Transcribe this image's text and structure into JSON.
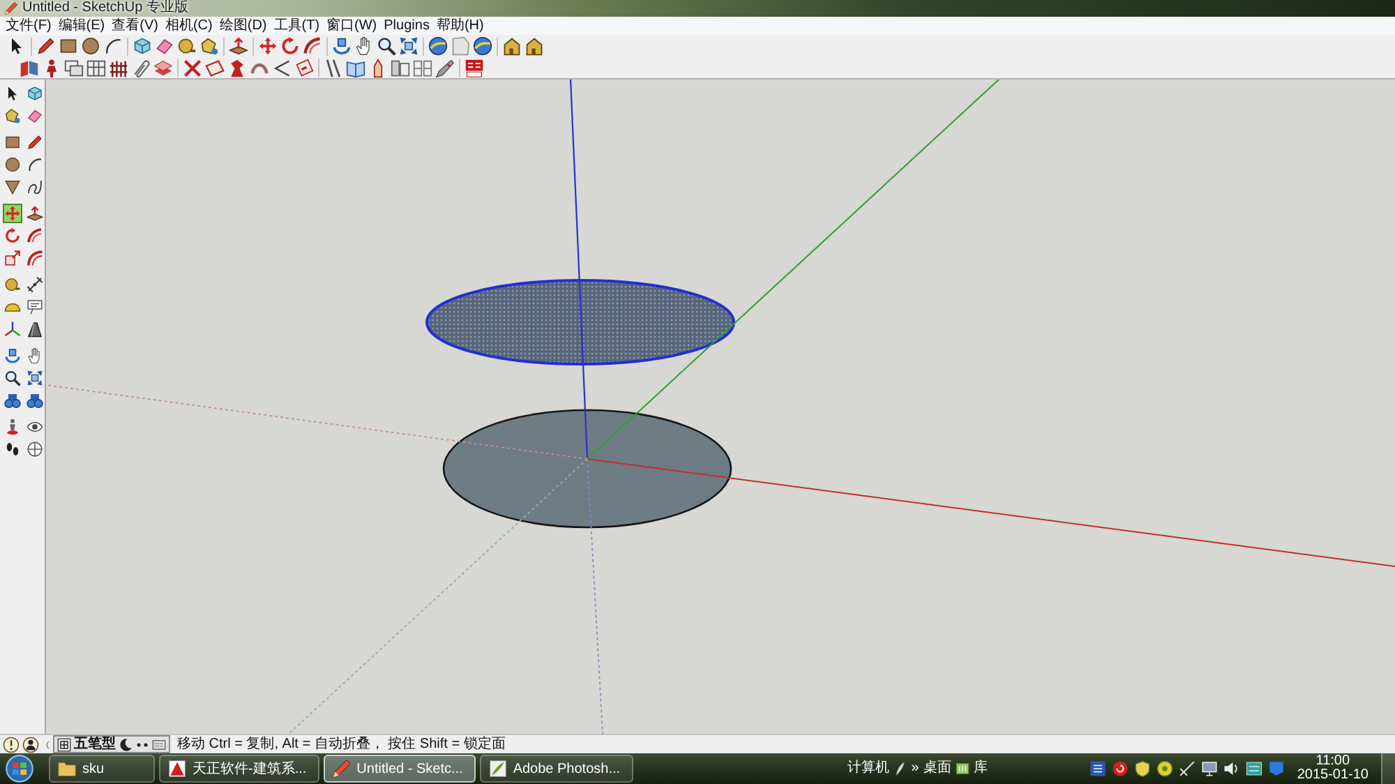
{
  "window": {
    "title": "Untitled - SketchUp 专业版"
  },
  "menu_bar": [
    "文件(F)",
    "编辑(E)",
    "查看(V)",
    "相机(C)",
    "绘图(D)",
    "工具(T)",
    "窗口(W)",
    "Plugins",
    "帮助(H)"
  ],
  "tool_palette": [
    {
      "selected": false
    },
    {
      "selected": false
    },
    {
      "selected": false
    },
    {
      "selected": false
    },
    {
      "selected": false
    },
    {
      "selected": false
    },
    {
      "selected": false
    },
    {
      "selected": false
    },
    {
      "selected": false
    },
    {
      "selected": false
    },
    {
      "selected": true
    },
    {
      "selected": false
    },
    {
      "selected": false
    },
    {
      "selected": false
    },
    {
      "selected": false
    },
    {
      "selected": false
    },
    {
      "selected": false
    },
    {
      "selected": false
    },
    {
      "selected": false
    },
    {
      "selected": false
    },
    {
      "selected": false
    },
    {
      "selected": false
    },
    {
      "selected": false
    },
    {
      "selected": false
    },
    {
      "selected": false
    },
    {
      "selected": false
    },
    {
      "selected": false
    },
    {
      "selected": false
    },
    {
      "selected": false
    },
    {
      "selected": false
    },
    {
      "selected": false
    },
    {
      "selected": false
    }
  ],
  "model": {
    "faces": [
      {
        "selected": true
      },
      {
        "selected": false
      }
    ]
  },
  "status_bar": {
    "ime_mode": "五笔型",
    "hint": "移动 Ctrl = 复制, Alt = 自动折叠， 按住 Shift = 锁定面"
  },
  "taskbar": {
    "items": [
      {
        "label": "sku",
        "selected": false
      },
      {
        "label": "天正软件-建筑系...",
        "selected": false
      },
      {
        "label": "Untitled - Sketc...",
        "selected": true
      },
      {
        "label": "Adobe Photosh...",
        "selected": false
      }
    ],
    "links": [
      "计算机",
      "»",
      "桌面",
      "库"
    ],
    "clock": {
      "time": "11:00",
      "date": "2015-01-10"
    }
  }
}
